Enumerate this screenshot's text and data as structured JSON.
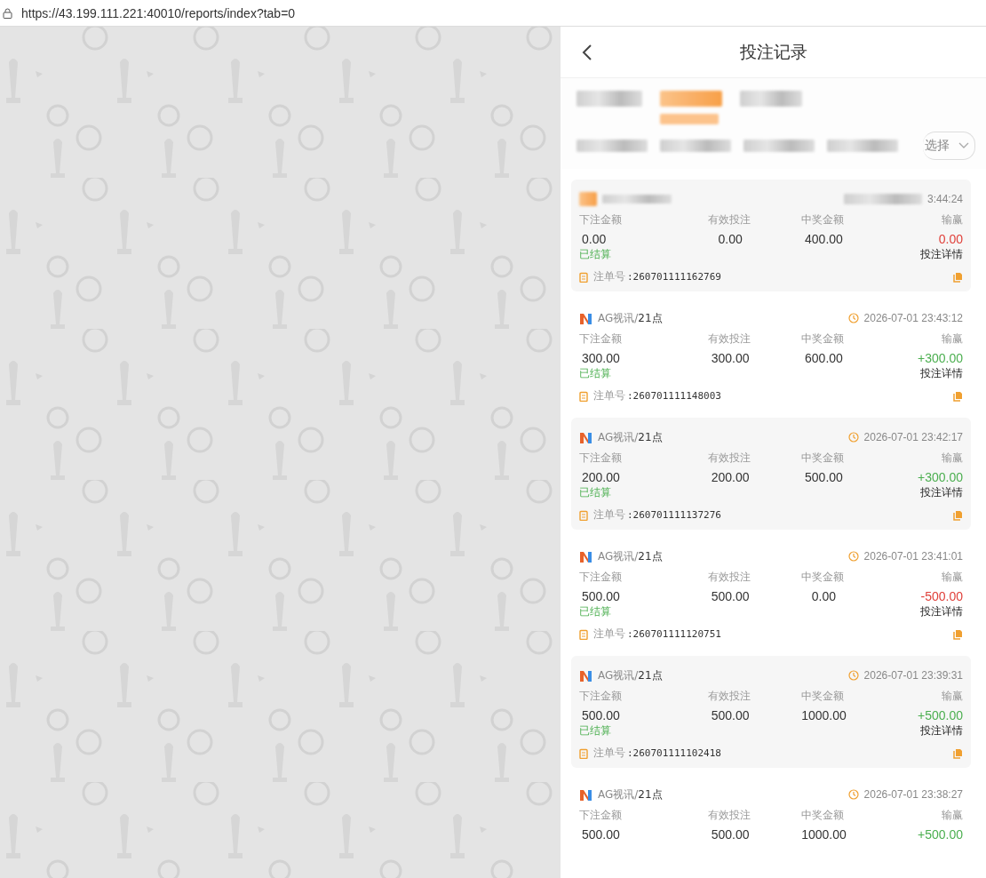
{
  "browser": {
    "url": "https://43.199.111.221:40010/reports/index?tab=0"
  },
  "header": {
    "title": "投注记录"
  },
  "filters": {
    "select_placeholder": "选择"
  },
  "cards": [
    {
      "kind": "blurred",
      "time": "3:44:24",
      "labels": [
        "下注金额",
        "有效投注",
        "中奖金额",
        "输赢"
      ],
      "values": [
        "0.00",
        "0.00",
        "400.00",
        "0.00"
      ],
      "color": "#e0403a",
      "status": "已结算",
      "detail": "投注详情",
      "order_label": "注单号",
      "order_no": ":260701111162769"
    },
    {
      "kind": "normal",
      "platform": "AG视讯/",
      "game": "21点",
      "time": "2026-07-01 23:43:12",
      "labels": [
        "下注金额",
        "有效投注",
        "中奖金额",
        "输赢"
      ],
      "values": [
        "300.00",
        "300.00",
        "600.00",
        "+300.00"
      ],
      "color": "#4caf50",
      "status": "已结算",
      "detail": "投注详情",
      "order_label": "注单号",
      "order_no": ":260701111148003"
    },
    {
      "kind": "normal",
      "platform": "AG视讯/",
      "game": "21点",
      "time": "2026-07-01 23:42:17",
      "labels": [
        "下注金额",
        "有效投注",
        "中奖金额",
        "输赢"
      ],
      "values": [
        "200.00",
        "200.00",
        "500.00",
        "+300.00"
      ],
      "color": "#4caf50",
      "status": "已结算",
      "detail": "投注详情",
      "order_label": "注单号",
      "order_no": ":260701111137276"
    },
    {
      "kind": "normal",
      "platform": "AG视讯/",
      "game": "21点",
      "time": "2026-07-01 23:41:01",
      "labels": [
        "下注金额",
        "有效投注",
        "中奖金额",
        "输赢"
      ],
      "values": [
        "500.00",
        "500.00",
        "0.00",
        "-500.00"
      ],
      "color": "#e0403a",
      "status": "已结算",
      "detail": "投注详情",
      "order_label": "注单号",
      "order_no": ":260701111120751"
    },
    {
      "kind": "normal",
      "platform": "AG视讯/",
      "game": "21点",
      "time": "2026-07-01 23:39:31",
      "labels": [
        "下注金额",
        "有效投注",
        "中奖金额",
        "输赢"
      ],
      "values": [
        "500.00",
        "500.00",
        "1000.00",
        "+500.00"
      ],
      "color": "#4caf50",
      "status": "已结算",
      "detail": "投注详情",
      "order_label": "注单号",
      "order_no": ":260701111102418"
    },
    {
      "kind": "normal",
      "platform": "AG视讯/",
      "game": "21点",
      "time": "2026-07-01 23:38:27",
      "labels": [
        "下注金额",
        "有效投注",
        "中奖金额",
        "输赢"
      ],
      "values": [
        "500.00",
        "500.00",
        "1000.00",
        "+500.00"
      ],
      "color": "#4caf50"
    }
  ]
}
